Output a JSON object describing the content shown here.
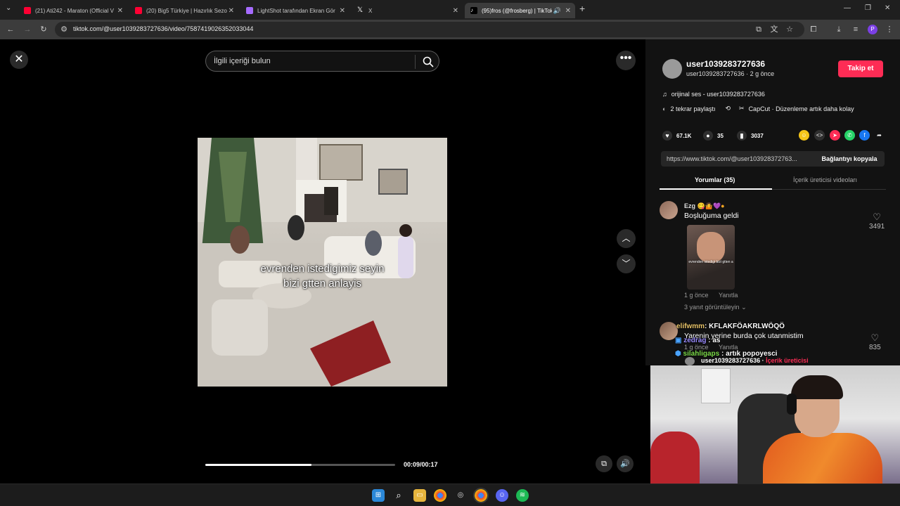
{
  "tabs": [
    {
      "label": "(21) Ati242 - Maraton (Official V",
      "icon": "youtube-icon",
      "color": "#ff0033"
    },
    {
      "label": "(20) Big5 Türkiye | Hazırlık Sezo",
      "icon": "youtube-icon",
      "color": "#ff0033"
    },
    {
      "label": "LightShot tarafından Ekran Gör",
      "icon": "lightshot-icon",
      "color": "#a66bff"
    },
    {
      "label": "X",
      "icon": "x-icon",
      "color": "#ffffff"
    },
    {
      "label": "(95)fros (@frosberg) | TikTok",
      "icon": "tiktok-icon",
      "color": "#ffffff"
    }
  ],
  "address_bar": {
    "url": "tiktok.com/@user1039283727636/video/7587419026352033044"
  },
  "player": {
    "search_placeholder": "İlgili içeriği bulun",
    "caption_line1": "evrenden istedigimiz seyin",
    "caption_line2": "bizi gtten anlayis",
    "time": "00:09/00:17",
    "progress": 0.56
  },
  "author": {
    "username": "user1039283727636",
    "subline": "user1039283727636 · 2 g önce",
    "follow_label": "Takip et",
    "sound": "orijinal ses - user1039283727636",
    "repost": "2 tekrar paylaştı",
    "capcut": "CapCut · Düzenleme artık daha kolay"
  },
  "stats": {
    "likes": "67.1K",
    "comments": "35",
    "saves": "3037"
  },
  "share": {
    "link": "https://www.tiktok.com/@user103928372763...",
    "copy_label": "Bağlantıyı kopyala"
  },
  "panel_tabs": {
    "comments": "Yorumlar (35)",
    "creator_videos": "İçerik üreticisi videoları"
  },
  "comments": [
    {
      "name": "Ezg",
      "text": "Boşluğuma geldi",
      "time": "1 g önce",
      "reply": "Yanıtla",
      "likes": "3491",
      "view_replies": "3 yanıt görüntüleyin",
      "sticker_text": "evrenden istedigi bizi gtten a"
    },
    {
      "name": "",
      "text": "Yarenin yerine burda çok utanmistim",
      "time": "1 g önce",
      "reply": "Yanıtla",
      "likes": "835"
    }
  ],
  "creator_row": {
    "name": "user1039283727636",
    "tag": "İçerik üreticisi"
  },
  "chat_overlay": [
    {
      "user": "elifwmm",
      "msg": "KFLAKFÖAKRLWÖQÖ",
      "color": "#e8c46a"
    },
    {
      "user": "zedrag",
      "msg": "as",
      "color": "#9b8cff"
    },
    {
      "user": "silahligaps",
      "msg": "artık popoyesci",
      "color": "#7ddc4a"
    }
  ],
  "colors": {
    "accent": "#fe2c55",
    "panel_bg": "#121212"
  }
}
